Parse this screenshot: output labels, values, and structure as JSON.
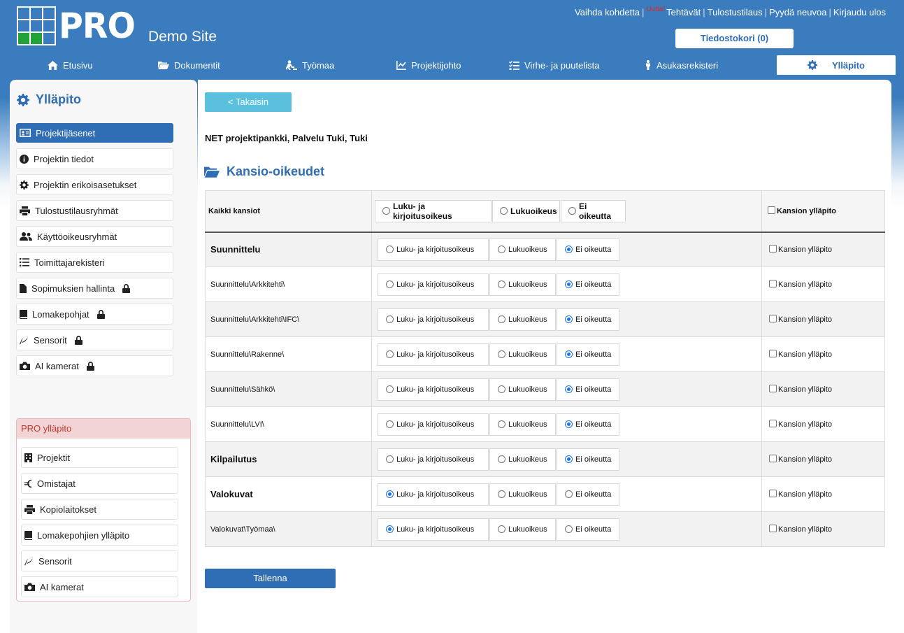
{
  "header": {
    "logo_text": "PRO",
    "site_name": "Demo Site",
    "top_links": {
      "change_site": "Vaihda kohdetta",
      "new_badge": "Uutta!",
      "tasks": "Tehtävät",
      "print_order": "Tulostustilaus",
      "ask_advice": "Pyydä neuvoa",
      "logout": "Kirjaudu ulos"
    },
    "basket_label": "Tiedostokori (0)"
  },
  "nav": {
    "home": "Etusivu",
    "documents": "Dokumentit",
    "worksite": "Työmaa",
    "project_management": "Projektijohto",
    "defects": "Virhe- ja puutelista",
    "residents": "Asukasrekisteri",
    "admin": "Ylläpito"
  },
  "sidebar": {
    "title": "Ylläpito",
    "items": [
      {
        "label": "Projektijäsenet"
      },
      {
        "label": "Projektin tiedot"
      },
      {
        "label": "Projektin erikoisasetukset"
      },
      {
        "label": "Tulostustilausryhmät"
      },
      {
        "label": "Käyttöoikeusryhmät"
      },
      {
        "label": "Toimittajarekisteri"
      },
      {
        "label": "Sopimuksien hallinta"
      },
      {
        "label": "Lomakepohjat"
      },
      {
        "label": "Sensorit"
      },
      {
        "label": "AI kamerat"
      }
    ],
    "pro_admin": {
      "title": "PRO ylläpito",
      "items": [
        {
          "label": "Projektit"
        },
        {
          "label": "Omistajat"
        },
        {
          "label": "Kopiolaitokset"
        },
        {
          "label": "Lomakepohjien ylläpito"
        },
        {
          "label": "Sensorit"
        },
        {
          "label": "AI kamerat"
        }
      ]
    }
  },
  "main": {
    "back_label": "< Takaisin",
    "project_path": "NET projektipankki, Palvelu Tuki, Tuki",
    "section_title": "Kansio-oikeudet",
    "table": {
      "all_folders": "Kaikki kansiot",
      "opt_rw": "Luku- ja kirjoitusoikeus",
      "opt_r": "Lukuoikeus",
      "opt_none": "Ei oikeutta",
      "admin_label": "Kansion ylläpito",
      "rows": [
        {
          "name": "Suunnittelu",
          "selected": "none"
        },
        {
          "name": "Suunnittelu\\Arkkitehti\\",
          "selected": "none"
        },
        {
          "name": "Suunnittelu\\Arkkitehti\\IFC\\",
          "selected": "none"
        },
        {
          "name": "Suunnittelu\\Rakenne\\",
          "selected": "none"
        },
        {
          "name": "Suunnittelu\\Sähkö\\",
          "selected": "none"
        },
        {
          "name": "Suunnittelu\\LVI\\",
          "selected": "none"
        },
        {
          "name": "Kilpailutus",
          "selected": "none"
        },
        {
          "name": "Valokuvat",
          "selected": "rw"
        },
        {
          "name": "Valokuvat\\Työmaa\\",
          "selected": "rw"
        }
      ]
    },
    "save_label": "Tallenna"
  }
}
